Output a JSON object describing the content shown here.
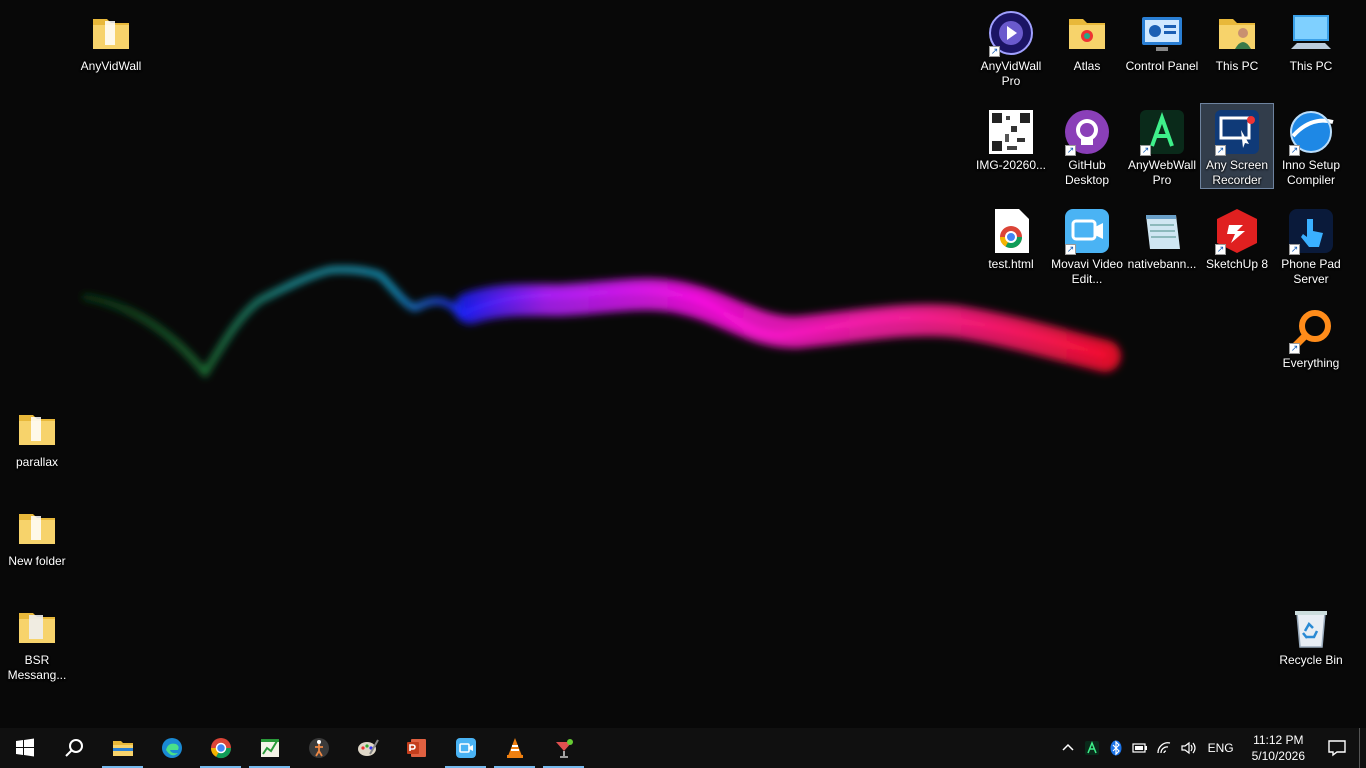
{
  "desktop": {
    "icons": [
      {
        "label": "AnyVidWall",
        "icon": "folder-icon"
      },
      {
        "label": "parallax",
        "icon": "folder-icon"
      },
      {
        "label": "New folder",
        "icon": "folder-icon"
      },
      {
        "label": "BSR Messang...",
        "icon": "folder-icon"
      },
      {
        "label": "AnyVidWall Pro",
        "icon": "anyvidwall-pro-icon"
      },
      {
        "label": "Atlas",
        "icon": "folder-icon"
      },
      {
        "label": "Control Panel",
        "icon": "control-panel-icon"
      },
      {
        "label": "This PC",
        "icon": "user-folder-icon"
      },
      {
        "label": "This PC",
        "icon": "computer-icon"
      },
      {
        "label": "IMG-20260...",
        "icon": "qr-image-icon"
      },
      {
        "label": "GitHub Desktop",
        "icon": "github-icon"
      },
      {
        "label": "AnyWebWall Pro",
        "icon": "anywebwall-icon"
      },
      {
        "label": "Any Screen Recorder",
        "icon": "screen-recorder-icon"
      },
      {
        "label": "Inno Setup Compiler",
        "icon": "inno-setup-icon"
      },
      {
        "label": "test.html",
        "icon": "chrome-html-icon"
      },
      {
        "label": "Movavi Video Edit...",
        "icon": "movavi-icon"
      },
      {
        "label": "nativebann...",
        "icon": "notepad-icon"
      },
      {
        "label": "SketchUp 8",
        "icon": "sketchup-icon"
      },
      {
        "label": "Phone Pad Server",
        "icon": "phone-pad-icon"
      },
      {
        "label": "Everything",
        "icon": "everything-search-icon"
      },
      {
        "label": "Recycle Bin",
        "icon": "recycle-bin-icon"
      }
    ]
  },
  "taskbar": {
    "apps": [
      {
        "name": "start-button",
        "icon": "windows-icon"
      },
      {
        "name": "search-button",
        "icon": "search-icon"
      },
      {
        "name": "file-explorer",
        "icon": "file-explorer-icon"
      },
      {
        "name": "edge",
        "icon": "edge-icon"
      },
      {
        "name": "chrome",
        "icon": "chrome-icon"
      },
      {
        "name": "app-chart",
        "icon": "chart-app-icon"
      },
      {
        "name": "app-figure",
        "icon": "figure-app-icon"
      },
      {
        "name": "app-paint",
        "icon": "paint-app-icon"
      },
      {
        "name": "powerpoint",
        "icon": "powerpoint-icon"
      },
      {
        "name": "app-recorder",
        "icon": "recorder-app-icon"
      },
      {
        "name": "vlc",
        "icon": "vlc-icon"
      },
      {
        "name": "app-cocktail",
        "icon": "cocktail-app-icon"
      }
    ],
    "tray": {
      "language": "ENG",
      "time": "11:12 PM",
      "date": "5/10/2026"
    }
  },
  "colors": {
    "taskbar_bg": "#101010",
    "desktop_bg": "#080808",
    "accent": "#76b9ed"
  }
}
